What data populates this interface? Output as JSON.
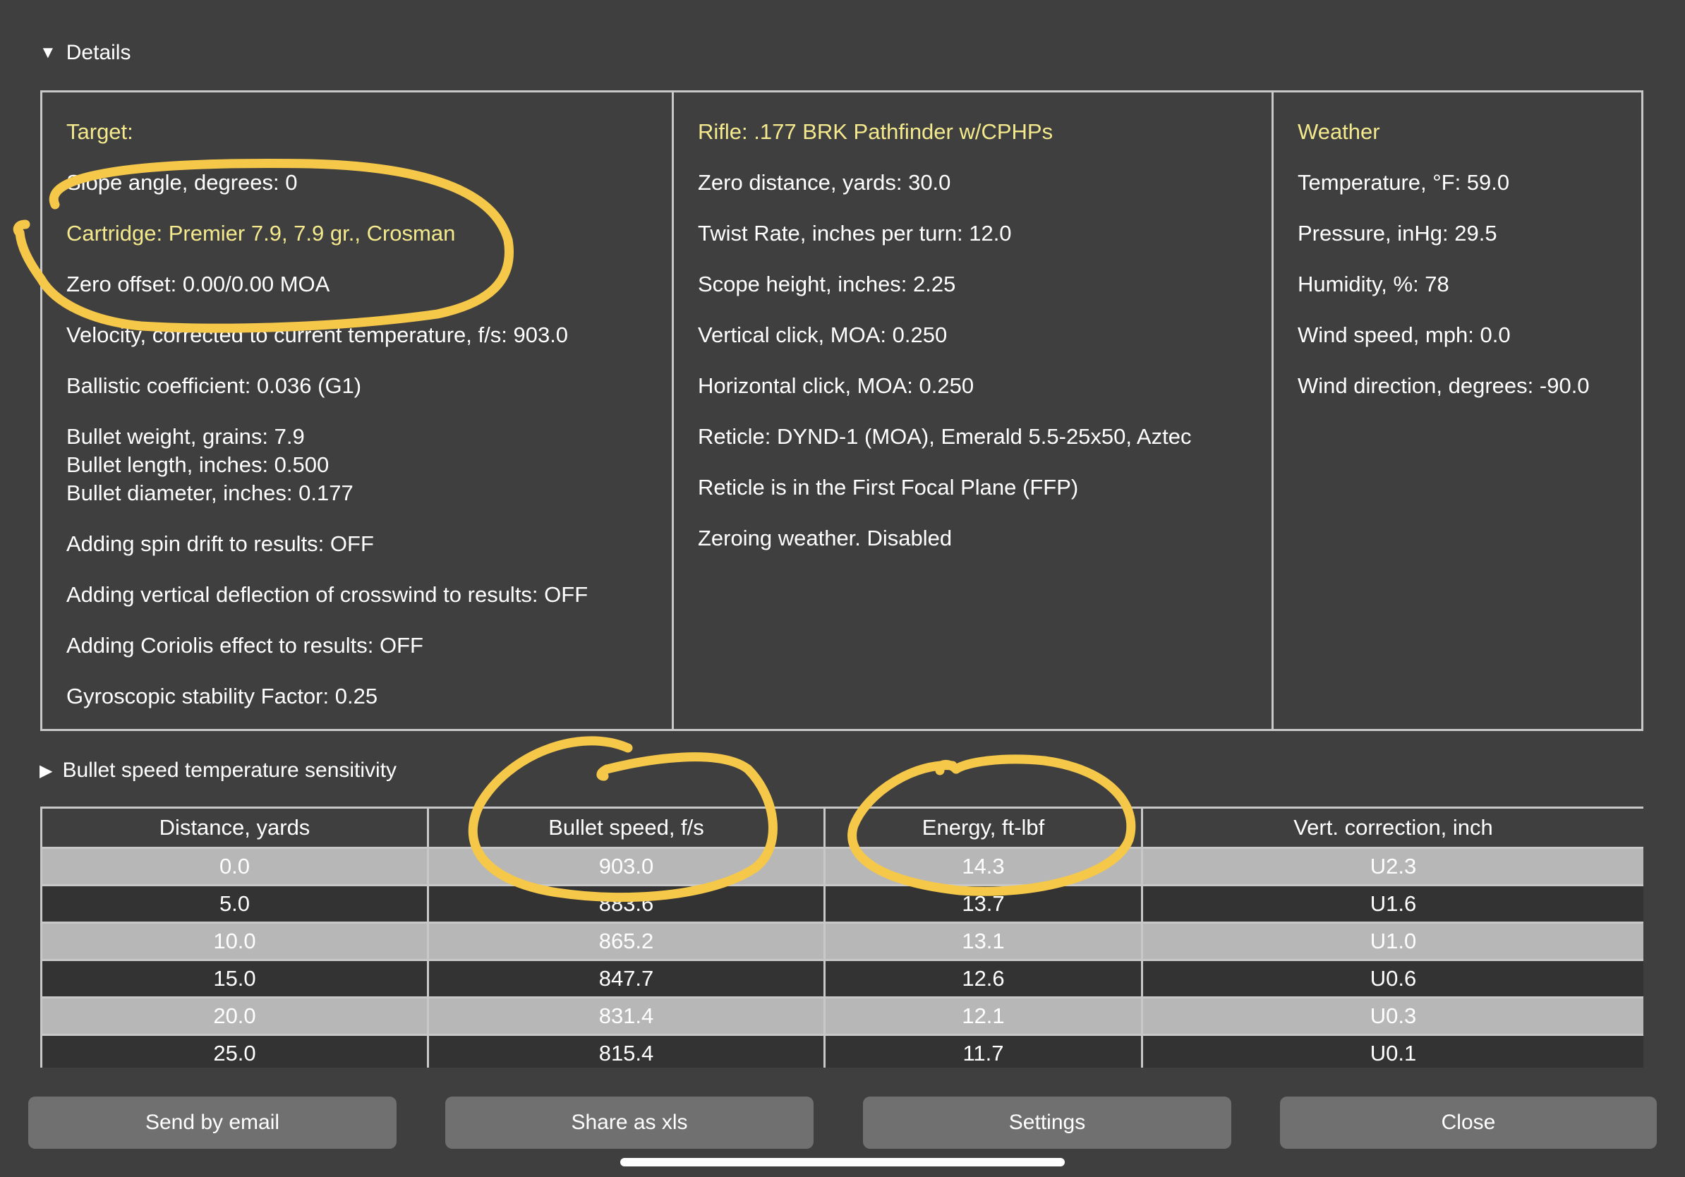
{
  "details": {
    "label": "Details",
    "toggle_icon": "triangle-down-icon"
  },
  "target": {
    "heading": "Target:",
    "slope": "Slope angle, degrees: 0",
    "cartridge": "Cartridge: Premier 7.9, 7.9 gr., Crosman",
    "zero_offset": "Zero offset: 0.00/0.00 MOA",
    "velocity": "Velocity, corrected to current temperature, f/s: 903.0",
    "bc": "Ballistic coefficient: 0.036 (G1)",
    "bullet_weight": "Bullet weight, grains: 7.9",
    "bullet_length": "Bullet length, inches: 0.500",
    "bullet_diameter": "Bullet diameter, inches: 0.177",
    "spin_drift": "Adding spin drift to results: OFF",
    "vertical_deflection": "Adding vertical deflection of crosswind to results: OFF",
    "coriolis": "Adding Coriolis effect to results: OFF",
    "gyro": "Gyroscopic stability Factor: 0.25"
  },
  "rifle": {
    "heading": "Rifle: .177 BRK Pathfinder w/CPHPs",
    "zero_distance": "Zero distance, yards: 30.0",
    "twist": "Twist Rate, inches per turn: 12.0",
    "scope_height": "Scope height, inches: 2.25",
    "vertical_click": "Vertical click, MOA: 0.250",
    "horizontal_click": "Horizontal click, MOA: 0.250",
    "reticle": "Reticle: DYND-1 (MOA), Emerald 5.5-25x50, Aztec",
    "focal_plane": "Reticle is in the First Focal Plane (FFP)",
    "zeroing_weather": "Zeroing weather. Disabled"
  },
  "weather": {
    "heading": "Weather",
    "temperature": "Temperature, °F: 59.0",
    "pressure": "Pressure, inHg: 29.5",
    "humidity": "Humidity, %: 78",
    "wind_speed": "Wind speed, mph: 0.0",
    "wind_direction": "Wind direction, degrees: -90.0"
  },
  "speed_sensitivity": {
    "label": "Bullet speed temperature sensitivity",
    "toggle_icon": "triangle-right-icon"
  },
  "table": {
    "headers": [
      "Distance, yards",
      "Bullet speed, f/s",
      "Energy, ft-lbf",
      "Vert. correction, inch"
    ],
    "rows": [
      [
        "0.0",
        "903.0",
        "14.3",
        "U2.3"
      ],
      [
        "5.0",
        "883.6",
        "13.7",
        "U1.6"
      ],
      [
        "10.0",
        "865.2",
        "13.1",
        "U1.0"
      ],
      [
        "15.0",
        "847.7",
        "12.6",
        "U0.6"
      ],
      [
        "20.0",
        "831.4",
        "12.1",
        "U0.3"
      ],
      [
        "25.0",
        "815.4",
        "11.7",
        "U0.1"
      ]
    ]
  },
  "buttons": {
    "email": "Send by email",
    "xls": "Share as xls",
    "settings": "Settings",
    "close": "Close"
  },
  "colors": {
    "background": "#3f3f3f",
    "heading_yellow": "#f4e98c",
    "row_light": "#b7b7b7",
    "row_dark": "#333333",
    "button": "#707070",
    "annotation": "#f5c84a"
  }
}
